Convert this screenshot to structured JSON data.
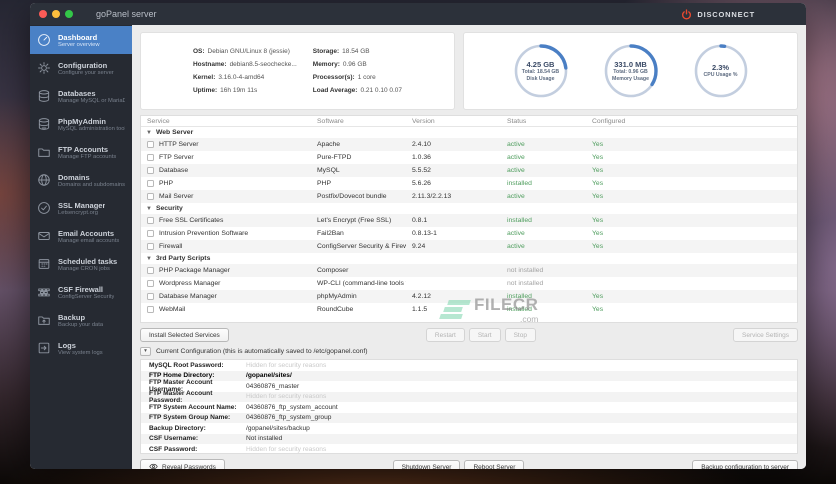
{
  "window": {
    "title": "goPanel server",
    "disconnect_label": "DISCONNECT"
  },
  "colors": {
    "accent_blue": "#4a81c6",
    "gauge_blue": "#4a7fc4",
    "status_green": "#4e9d5d",
    "disconnect_red": "#e8492f",
    "titlebar": "#2c313a",
    "sidebar_bg": "#262a32"
  },
  "sidebar": {
    "items": [
      {
        "icon": "dashboard-gauge-icon",
        "label": "Dashboard",
        "sublabel": "Server overview",
        "active": true
      },
      {
        "icon": "gear-icon",
        "label": "Configuration",
        "sublabel": "Configure your server",
        "active": false
      },
      {
        "icon": "database-icon",
        "label": "Databases",
        "sublabel": "Manage MySQL or MariaDB",
        "active": false
      },
      {
        "icon": "database-admin-icon",
        "label": "PhpMyAdmin",
        "sublabel": "MySQL administration tool",
        "active": false
      },
      {
        "icon": "folder-icon",
        "label": "FTP Accounts",
        "sublabel": "Manage FTP accounts",
        "active": false
      },
      {
        "icon": "globe-icon",
        "label": "Domains",
        "sublabel": "Domains and subdomains",
        "active": false
      },
      {
        "icon": "shield-check-icon",
        "label": "SSL Manager",
        "sublabel": "Letsencrypt.org",
        "active": false
      },
      {
        "icon": "envelope-icon",
        "label": "Email Accounts",
        "sublabel": "Manage email accounts",
        "active": false
      },
      {
        "icon": "calendar-grid-icon",
        "label": "Scheduled tasks",
        "sublabel": "Manage CRON jobs",
        "active": false
      },
      {
        "icon": "firewall-bricks-icon",
        "label": "CSF Firewall",
        "sublabel": "ConfigServer Security",
        "active": false
      },
      {
        "icon": "backup-folder-icon",
        "label": "Backup",
        "sublabel": "Backup your data",
        "active": false
      },
      {
        "icon": "logs-arrow-icon",
        "label": "Logs",
        "sublabel": "View system logs",
        "active": false
      }
    ]
  },
  "server_info": {
    "left": [
      {
        "label": "OS:",
        "value": "Debian GNU/Linux 8 (jessie)"
      },
      {
        "label": "Hostname:",
        "value": "debian8.5-seochecke..."
      },
      {
        "label": "Kernel:",
        "value": "3.16.0-4-amd64"
      },
      {
        "label": "Uptime:",
        "value": "16h 19m 11s"
      }
    ],
    "right": [
      {
        "label": "Storage:",
        "value": "18.54 GB"
      },
      {
        "label": "Memory:",
        "value": "0.96 GB"
      },
      {
        "label": "Processor(s):",
        "value": "1 core"
      },
      {
        "label": "Load Average:",
        "value": "0.21 0.10 0.07"
      }
    ]
  },
  "gauges": [
    {
      "value": "4.25 GB",
      "line2": "Total: 18.54 GB",
      "line3": "Disk Usage",
      "percent": 23
    },
    {
      "value": "331.0 MB",
      "line2": "Total: 0.96 GB",
      "line3": "Memory Usage",
      "percent": 34
    },
    {
      "value": "2.3%",
      "line2": "CPU Usage %",
      "line3": "",
      "percent": 2.3
    }
  ],
  "services": {
    "columns": [
      "Service",
      "Software",
      "Version",
      "Status",
      "Configured"
    ],
    "groups": [
      {
        "name": "Web Server",
        "rows": [
          {
            "service": "HTTP Server",
            "software": "Apache",
            "version": "2.4.10",
            "status": "active",
            "status_type": "green",
            "configured": "Yes"
          },
          {
            "service": "FTP Server",
            "software": "Pure-FTPD",
            "version": "1.0.36",
            "status": "active",
            "status_type": "green",
            "configured": "Yes"
          },
          {
            "service": "Database",
            "software": "MySQL",
            "version": "5.5.52",
            "status": "active",
            "status_type": "green",
            "configured": "Yes"
          },
          {
            "service": "PHP",
            "software": "PHP",
            "version": "5.6.26",
            "status": "installed",
            "status_type": "green",
            "configured": "Yes"
          },
          {
            "service": "Mail Server",
            "software": "Postfix/Dovecot bundle",
            "version": "2.11.3/2.2.13",
            "status": "active",
            "status_type": "green",
            "configured": "Yes"
          }
        ]
      },
      {
        "name": "Security",
        "rows": [
          {
            "service": "Free SSL Certificates",
            "software": "Let's Encrypt (Free SSL)",
            "version": "0.8.1",
            "status": "installed",
            "status_type": "green",
            "configured": "Yes"
          },
          {
            "service": "Intrusion Prevention Software",
            "software": "Fail2Ban",
            "version": "0.8.13-1",
            "status": "active",
            "status_type": "green",
            "configured": "Yes"
          },
          {
            "service": "Firewall",
            "software": "ConfigServer Security & Firewall",
            "version": "9.24",
            "status": "active",
            "status_type": "green",
            "configured": "Yes"
          }
        ]
      },
      {
        "name": "3rd Party Scripts",
        "rows": [
          {
            "service": "PHP Package Manager",
            "software": "Composer",
            "version": "",
            "status": "not installed",
            "status_type": "muted",
            "configured": ""
          },
          {
            "service": "Wordpress Manager",
            "software": "WP-CLI (command-line tools for WordPress)",
            "version": "",
            "status": "not installed",
            "status_type": "muted",
            "configured": ""
          },
          {
            "service": "Database Manager",
            "software": "phpMyAdmin",
            "version": "4.2.12",
            "status": "installed",
            "status_type": "green",
            "configured": "Yes"
          },
          {
            "service": "WebMail",
            "software": "RoundCube",
            "version": "1.1.5",
            "status": "installed",
            "status_type": "green",
            "configured": "Yes"
          }
        ]
      }
    ]
  },
  "actions": {
    "install_label": "Install Selected Services",
    "restart_label": "Restart",
    "start_label": "Start",
    "stop_label": "Stop",
    "settings_label": "Service Settings"
  },
  "config": {
    "header": "Current Configuration (this is automatically saved to /etc/gopanel.conf)",
    "rows": [
      {
        "label": "MySQL Root Password:",
        "value": "Hidden for security reasons",
        "muted": true,
        "bold": false
      },
      {
        "label": "FTP Home Directory:",
        "value": "/gopanel/sites/",
        "muted": false,
        "bold": true
      },
      {
        "label": "FTP Master Account Username:",
        "value": "04360876_master",
        "muted": false,
        "bold": false
      },
      {
        "label": "FTP Master Account Password:",
        "value": "Hidden for security reasons",
        "muted": true,
        "bold": false
      },
      {
        "label": "FTP System Account Name:",
        "value": "04360876_ftp_system_account",
        "muted": false,
        "bold": false
      },
      {
        "label": "FTP System Group Name:",
        "value": "04360876_ftp_system_group",
        "muted": false,
        "bold": false
      },
      {
        "label": "Backup Directory:",
        "value": "/gopanel/sites/backup",
        "muted": false,
        "bold": false
      },
      {
        "label": "CSF Username:",
        "value": "Not installed",
        "muted": false,
        "bold": false
      },
      {
        "label": "CSF Password:",
        "value": "Hidden for security reasons",
        "muted": true,
        "bold": false
      }
    ]
  },
  "footer": {
    "reveal_label": "Reveal Passwords",
    "shutdown_label": "Shutdown Server",
    "reboot_label": "Reboot Server",
    "backup_label": "Backup configuration to server"
  },
  "watermark": {
    "text": "FILECR",
    "suffix": ".com"
  }
}
